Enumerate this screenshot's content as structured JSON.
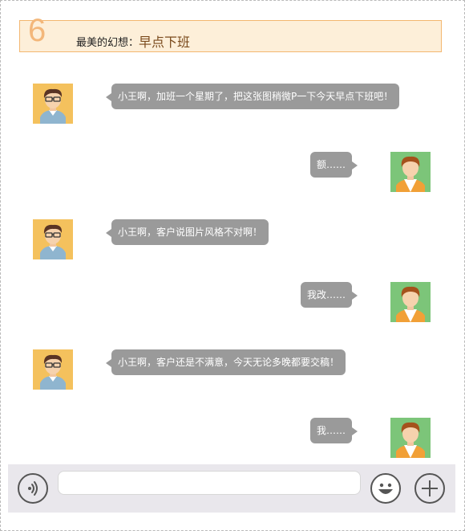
{
  "header": {
    "number": "6",
    "label": "最美的幻想：",
    "highlight": "早点下班"
  },
  "messages": [
    {
      "side": "left",
      "sender": "boss",
      "text": "小王啊，加班一个星期了，把这张图稍微P一下今天早点下班吧！"
    },
    {
      "side": "right",
      "sender": "me",
      "text": "额……"
    },
    {
      "side": "left",
      "sender": "boss",
      "text": "小王啊，客户说图片风格不对啊！"
    },
    {
      "side": "right",
      "sender": "me",
      "text": "我改……"
    },
    {
      "side": "left",
      "sender": "boss",
      "text": "小王啊，客户还是不满意，今天无论多晚都要交稿！"
    },
    {
      "side": "right",
      "sender": "me",
      "text": "我……"
    }
  ],
  "input_bar": {
    "text_value": "",
    "icons": [
      "voice-icon",
      "emoji-icon",
      "plus-icon"
    ]
  },
  "colors": {
    "header_bg": "#fdefd9",
    "header_border": "#f3b770",
    "number": "#f3b77a",
    "bubble": "#9a9a9a",
    "boss_avatar_bg": "#f4c15d",
    "me_avatar_bg": "#7cc579",
    "input_bar_bg": "#e9e7ec"
  }
}
